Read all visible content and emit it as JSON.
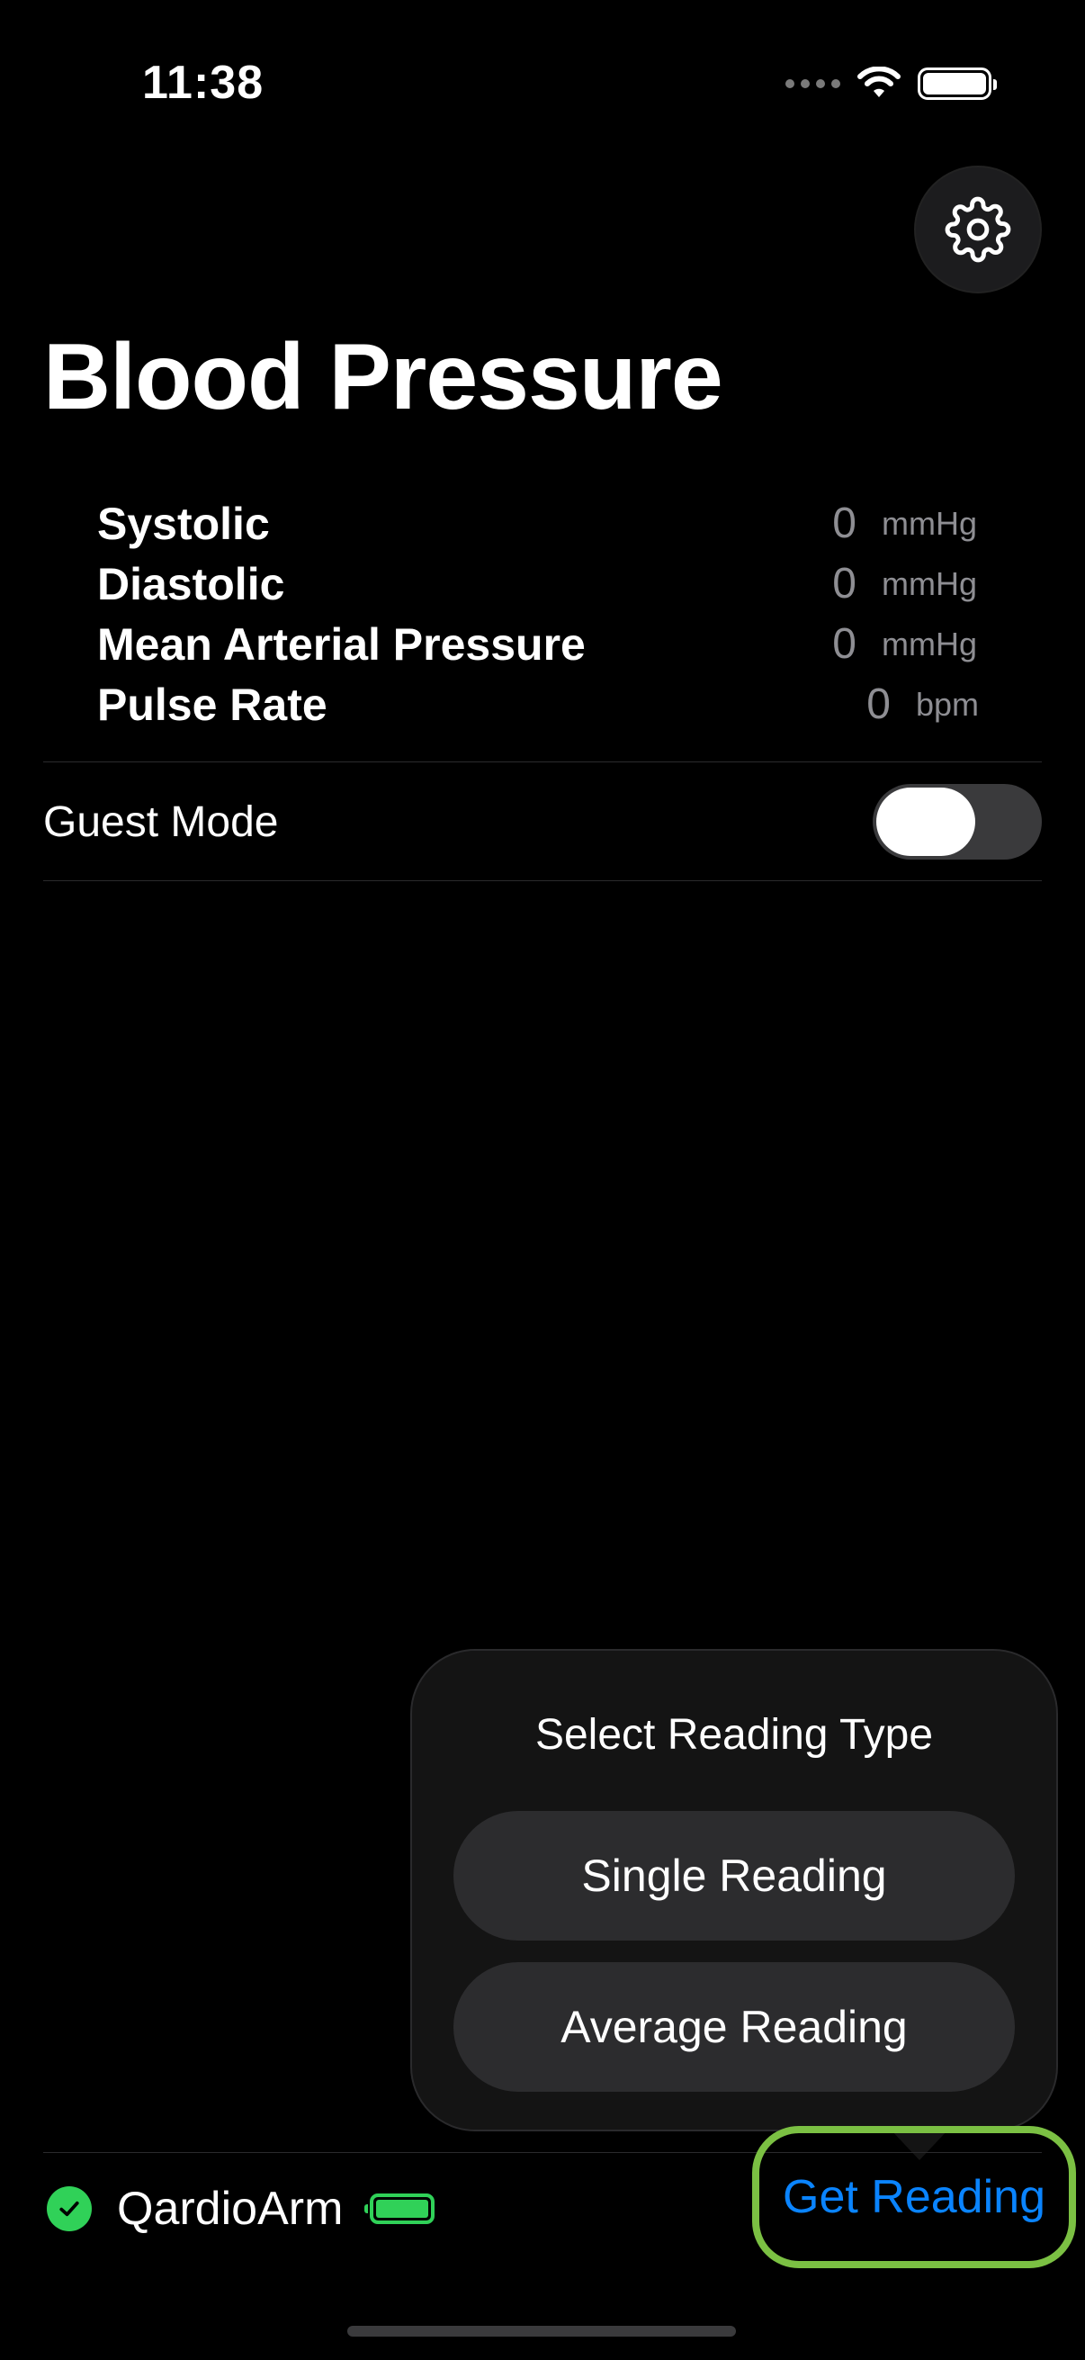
{
  "status_bar": {
    "time": "11:38"
  },
  "header": {
    "title": "Blood Pressure"
  },
  "readings": [
    {
      "label": "Systolic",
      "value": "0",
      "unit": "mmHg"
    },
    {
      "label": "Diastolic",
      "value": "0",
      "unit": "mmHg"
    },
    {
      "label": "Mean Arterial Pressure",
      "value": "0",
      "unit": "mmHg"
    },
    {
      "label": "Pulse Rate",
      "value": "0",
      "unit": "bpm"
    }
  ],
  "guest_mode": {
    "label": "Guest Mode",
    "enabled": false
  },
  "popover": {
    "title": "Select Reading Type",
    "options": [
      "Single Reading",
      "Average Reading"
    ]
  },
  "device": {
    "name": "QardioArm",
    "connected": true
  },
  "actions": {
    "get_reading": "Get Reading"
  },
  "colors": {
    "accent": "#0a84ff",
    "success": "#30d158",
    "highlight": "#7bc043"
  },
  "icons": {
    "settings": "gear-icon",
    "connected": "checkmark-icon",
    "device_battery": "battery-icon",
    "wifi": "wifi-icon",
    "signal": "cellular-dots-icon"
  }
}
